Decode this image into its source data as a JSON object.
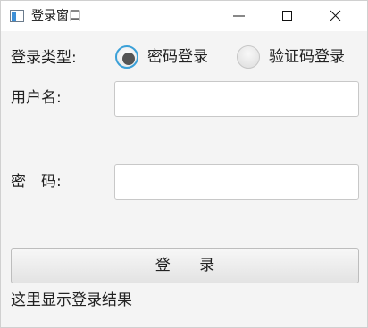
{
  "window": {
    "title": "登录窗口",
    "icon": "window-app-icon",
    "controls": [
      "minimize-icon",
      "maximize-icon",
      "close-icon"
    ]
  },
  "form": {
    "login_type_label": "登录类型:",
    "login_types": [
      {
        "label": "密码登录",
        "selected": true
      },
      {
        "label": "验证码登录",
        "selected": false
      }
    ],
    "username_label": "用户名:",
    "username_value": "",
    "password_label": "密　码:",
    "password_value": "",
    "login_button_label": "登      录",
    "result_text": "这里显示登录结果"
  },
  "colors": {
    "radio_selected_ring": "#3aa0d8",
    "radio_dot": "#555555",
    "background": "#f4f4f4"
  }
}
